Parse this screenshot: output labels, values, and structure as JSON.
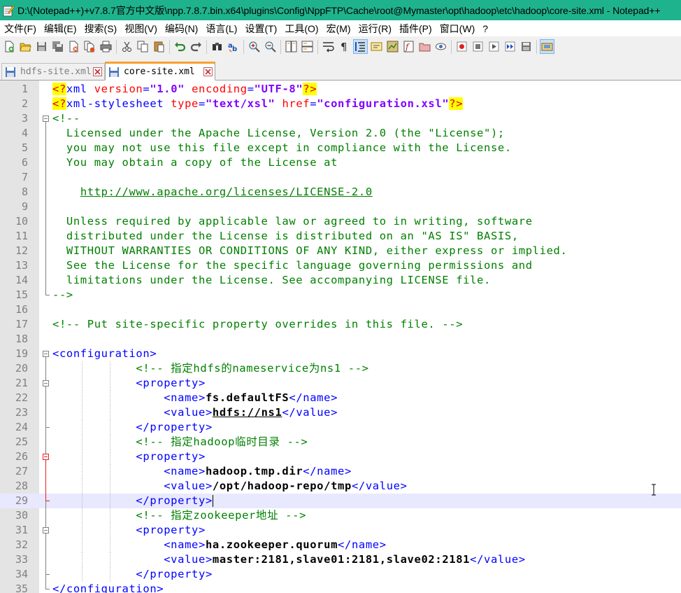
{
  "window": {
    "title": "D:\\(Notepad++)+v7.8.7官方中文版\\npp.7.8.7.bin.x64\\plugins\\Config\\NppFTP\\Cache\\root@Mymaster\\opt\\hadoop\\etc\\hadoop\\core-site.xml - Notepad++"
  },
  "menu": [
    "文件(F)",
    "编辑(E)",
    "搜索(S)",
    "视图(V)",
    "编码(N)",
    "语言(L)",
    "设置(T)",
    "工具(O)",
    "宏(M)",
    "运行(R)",
    "插件(P)",
    "窗口(W)",
    "?"
  ],
  "tabs": [
    {
      "label": "hdfs-site.xml",
      "active": false
    },
    {
      "label": "core-site.xml",
      "active": true
    }
  ],
  "colors": {
    "titlebar": "#1fb38d",
    "tab_accent": "#f9a12f",
    "current_line": "#e8e8ff"
  },
  "editor": {
    "current_line": 29,
    "lines": [
      {
        "n": "1",
        "parts": [
          [
            "pi",
            "<?"
          ],
          [
            "tag",
            "xml "
          ],
          [
            "attr",
            "version"
          ],
          [
            "tag",
            "="
          ],
          [
            "str",
            "\"1.0\""
          ],
          [
            "tag",
            " "
          ],
          [
            "attr",
            "encoding"
          ],
          [
            "tag",
            "="
          ],
          [
            "str",
            "\"UTF-8\""
          ],
          [
            "pi",
            "?>"
          ]
        ]
      },
      {
        "n": "2",
        "parts": [
          [
            "pi",
            "<?"
          ],
          [
            "tag",
            "xml-stylesheet "
          ],
          [
            "attr",
            "type"
          ],
          [
            "tag",
            "="
          ],
          [
            "str",
            "\"text/xsl\""
          ],
          [
            "tag",
            " "
          ],
          [
            "attr",
            "href"
          ],
          [
            "tag",
            "="
          ],
          [
            "str",
            "\"configuration.xsl\""
          ],
          [
            "pi",
            "?>"
          ]
        ]
      },
      {
        "n": "3",
        "parts": [
          [
            "com",
            "<!--"
          ]
        ]
      },
      {
        "n": "4",
        "parts": [
          [
            "com",
            "  Licensed under the Apache License, Version 2.0 (the \"License\");"
          ]
        ]
      },
      {
        "n": "5",
        "parts": [
          [
            "com",
            "  you may not use this file except in compliance with the License."
          ]
        ]
      },
      {
        "n": "6",
        "parts": [
          [
            "com",
            "  You may obtain a copy of the License at"
          ]
        ]
      },
      {
        "n": "7",
        "parts": []
      },
      {
        "n": "8",
        "parts": [
          [
            "com",
            "    "
          ],
          [
            "link",
            "http://www.apache.org/licenses/LICENSE-2.0"
          ]
        ]
      },
      {
        "n": "9",
        "parts": []
      },
      {
        "n": "10",
        "parts": [
          [
            "com",
            "  Unless required by applicable law or agreed to in writing, software"
          ]
        ]
      },
      {
        "n": "11",
        "parts": [
          [
            "com",
            "  distributed under the License is distributed on an \"AS IS\" BASIS,"
          ]
        ]
      },
      {
        "n": "12",
        "parts": [
          [
            "com",
            "  WITHOUT WARRANTIES OR CONDITIONS OF ANY KIND, either express or implied."
          ]
        ]
      },
      {
        "n": "13",
        "parts": [
          [
            "com",
            "  See the License for the specific language governing permissions and"
          ]
        ]
      },
      {
        "n": "14",
        "parts": [
          [
            "com",
            "  limitations under the License. See accompanying LICENSE file."
          ]
        ]
      },
      {
        "n": "15",
        "parts": [
          [
            "com",
            "-->"
          ]
        ]
      },
      {
        "n": "16",
        "parts": []
      },
      {
        "n": "17",
        "parts": [
          [
            "com",
            "<!-- Put site-specific property overrides in this file. -->"
          ]
        ]
      },
      {
        "n": "18",
        "parts": []
      },
      {
        "n": "19",
        "parts": [
          [
            "tag",
            "<configuration>"
          ]
        ]
      },
      {
        "n": "20",
        "parts": [
          [
            "ws",
            "            "
          ],
          [
            "com",
            "<!-- 指定hdfs的nameservice为ns1 -->"
          ]
        ]
      },
      {
        "n": "21",
        "parts": [
          [
            "ws",
            "            "
          ],
          [
            "tag",
            "<property>"
          ]
        ]
      },
      {
        "n": "22",
        "parts": [
          [
            "ws",
            "                "
          ],
          [
            "tag",
            "<name>"
          ],
          [
            "txt",
            "fs.defaultFS"
          ],
          [
            "tag",
            "</name>"
          ]
        ]
      },
      {
        "n": "23",
        "parts": [
          [
            "ws",
            "                "
          ],
          [
            "tag",
            "<value>"
          ],
          [
            "txtu",
            "hdfs://ns1"
          ],
          [
            "tag",
            "</value>"
          ]
        ]
      },
      {
        "n": "24",
        "parts": [
          [
            "ws",
            "            "
          ],
          [
            "tag",
            "</property>"
          ]
        ]
      },
      {
        "n": "25",
        "parts": [
          [
            "ws",
            "            "
          ],
          [
            "com",
            "<!-- 指定hadoop临时目录 -->"
          ]
        ]
      },
      {
        "n": "26",
        "parts": [
          [
            "ws",
            "            "
          ],
          [
            "tag",
            "<property>"
          ]
        ]
      },
      {
        "n": "27",
        "parts": [
          [
            "ws",
            "                "
          ],
          [
            "tag",
            "<name>"
          ],
          [
            "txt",
            "hadoop.tmp.dir"
          ],
          [
            "tag",
            "</name>"
          ]
        ]
      },
      {
        "n": "28",
        "parts": [
          [
            "ws",
            "                "
          ],
          [
            "tag",
            "<value>"
          ],
          [
            "txt",
            "/opt/hadoop-repo/tmp"
          ],
          [
            "tag",
            "</value>"
          ]
        ]
      },
      {
        "n": "29",
        "parts": [
          [
            "ws",
            "            "
          ],
          [
            "tag",
            "</property>"
          ],
          [
            "caret",
            ""
          ]
        ]
      },
      {
        "n": "30",
        "parts": [
          [
            "ws",
            "            "
          ],
          [
            "com",
            "<!-- 指定zookeeper地址 -->"
          ]
        ]
      },
      {
        "n": "31",
        "parts": [
          [
            "ws",
            "            "
          ],
          [
            "tag",
            "<property>"
          ]
        ]
      },
      {
        "n": "32",
        "parts": [
          [
            "ws",
            "                "
          ],
          [
            "tag",
            "<name>"
          ],
          [
            "txt",
            "ha.zookeeper.quorum"
          ],
          [
            "tag",
            "</name>"
          ]
        ]
      },
      {
        "n": "33",
        "parts": [
          [
            "ws",
            "                "
          ],
          [
            "tag",
            "<value>"
          ],
          [
            "txt",
            "master:2181,slave01:2181,slave02:2181"
          ],
          [
            "tag",
            "</value>"
          ]
        ]
      },
      {
        "n": "34",
        "parts": [
          [
            "ws",
            "            "
          ],
          [
            "tag",
            "</property>"
          ]
        ]
      },
      {
        "n": "35",
        "parts": [
          [
            "tag",
            "</configuration>"
          ]
        ]
      }
    ]
  }
}
